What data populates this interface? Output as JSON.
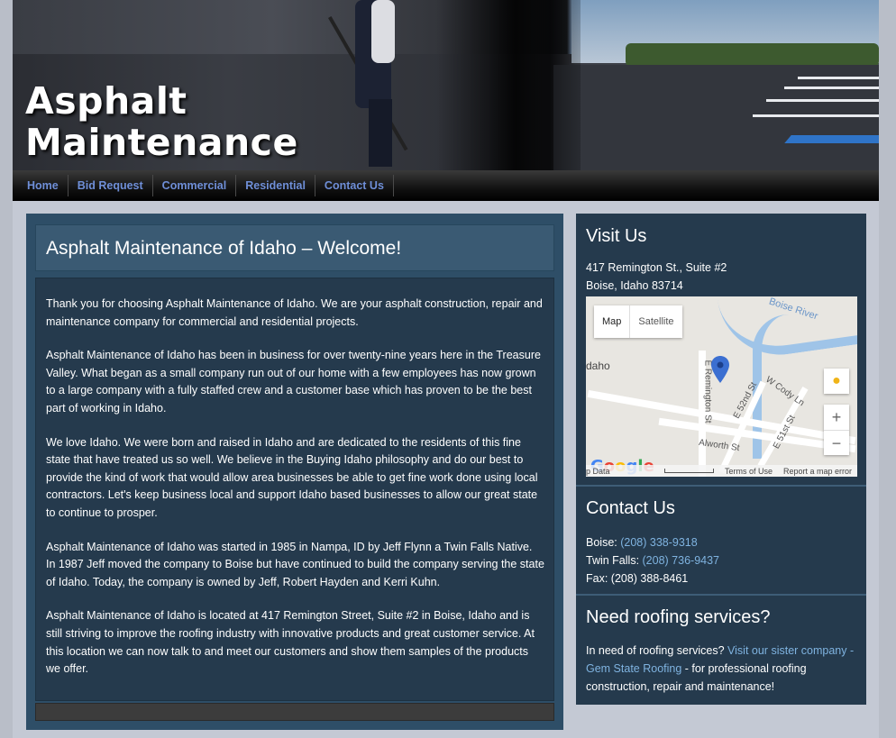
{
  "banner": {
    "title_line1": "Asphalt",
    "title_line2": "Maintenance"
  },
  "nav": {
    "items": [
      "Home",
      "Bid Request",
      "Commercial",
      "Residential",
      "Contact Us"
    ]
  },
  "main": {
    "title": "Asphalt Maintenance of Idaho – Welcome!",
    "paragraphs": [
      "Thank you for choosing Asphalt Maintenance of Idaho. We are your asphalt construction, repair and maintenance company for commercial and residential projects.",
      "Asphalt Maintenance of Idaho has been in business for over twenty-nine years here in the Treasure Valley. What began as a small company run out of our home with a few employees has now grown to a large company with a fully staffed crew and a customer base which has proven to be the best part of working in Idaho.",
      "We love Idaho. We were born and raised in Idaho and are dedicated to the residents of this fine state that have treated us so well. We believe in the Buying Idaho philosophy and do our best to provide the kind of work that would allow area businesses be able to get fine work done using local contractors. Let's keep business local and support Idaho based businesses to allow our great state to continue to prosper.",
      "Asphalt Maintenance of Idaho was started in 1985 in Nampa, ID by Jeff Flynn a Twin Falls Native. In 1987 Jeff moved the company to Boise but have continued to build the company serving the state of Idaho. Today, the company is owned by Jeff, Robert Hayden and Kerri Kuhn.",
      "Asphalt Maintenance of Idaho is located at 417 Remington Street, Suite #2 in Boise, Idaho and is still striving to improve the roofing industry with innovative products and great customer service. At this location we can now talk to and meet our customers and show them samples of the products we offer."
    ]
  },
  "visit": {
    "heading": "Visit Us",
    "address1": "417 Remington St., Suite #2",
    "address2": "Boise, Idaho 83714",
    "map": {
      "map_btn": "Map",
      "satellite_btn": "Satellite",
      "labels": {
        "river": "Boise River",
        "idaho": "daho",
        "remington": "E Remington St",
        "st52": "E 52nd St",
        "cody": "W Cody Ln",
        "st51": "E 51st St",
        "alworth": "Alworth St"
      },
      "zoom_in": "+",
      "zoom_out": "−",
      "footer_data": "p Data",
      "footer_terms": "Terms of Use",
      "footer_report": "Report a map error"
    }
  },
  "contact": {
    "heading": "Contact Us",
    "boise_label": "Boise: ",
    "boise_phone": "(208) 338-9318",
    "twin_label": "Twin Falls: ",
    "twin_phone": "(208) 736-9437",
    "fax": "Fax: (208) 388-8461"
  },
  "roofing": {
    "heading": "Need roofing services?",
    "text_before": "In need of roofing services? ",
    "link": "Visit our sister company - Gem State Roofing",
    "text_after": " - for professional roofing construction, repair and maintenance!"
  },
  "colors": {
    "nav_link": "#6f8fd8",
    "panel": "#253a4d",
    "header": "#3a5a73",
    "link": "#7fb3e0"
  }
}
